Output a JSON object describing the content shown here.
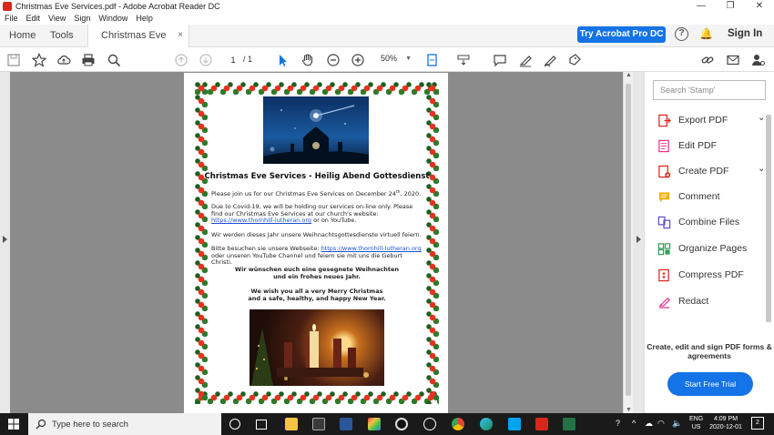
{
  "window": {
    "title": "Christmas Eve Services.pdf - Adobe Acrobat Reader DC",
    "min": "—",
    "max": "❐",
    "close": "✕"
  },
  "menu": [
    "File",
    "Edit",
    "View",
    "Sign",
    "Window",
    "Help"
  ],
  "tabs": {
    "home": "Home",
    "tools": "Tools",
    "doc": "Christmas Eve Servi...",
    "doc_close": "×"
  },
  "header": {
    "try_label": "Try Acrobat Pro DC",
    "help": "?",
    "signin": "Sign In"
  },
  "toolbar": {
    "page_current": "1",
    "page_total": "/ 1",
    "zoom": "50%"
  },
  "document": {
    "heading": "Christmas Eve Services - Heilig Abend Gottesdienst",
    "p1_a": "Please join us for our Christmas Eve Services on December 24",
    "p1_sup": "th",
    "p1_b": ", 2020.",
    "p2": "Due to Covid-19, we will be holding our services on-line only. Please find our Christmas Eve Services at our church's website:",
    "link1": "https://www.thornhill-lutheran.org",
    "p2_tail": " or on YouTube.",
    "p3": "Wir werden dieses Jahr unsere Weihnachtsgottesdienste virtuell feiern.",
    "p4_a": "Bitte besuchen sie unsere Webseite: ",
    "link2": "https://www.thornhill-lutheran.org",
    "p4_b": "oder unseren YouTube Channel und feiern sie mit uns die Geburt Christi.",
    "greet_de_1": "Wir wünschen euch eine gesegnete Weihnachten",
    "greet_de_2": "und ein frohes neues Jahr.",
    "greet_en_1": "We wish you all a very Merry Christmas",
    "greet_en_2": "and a safe, healthy, and happy New Year."
  },
  "panel": {
    "search_placeholder": "Search 'Stamp'",
    "tools": [
      {
        "label": "Export PDF",
        "color": "#d9261c"
      },
      {
        "label": "Edit PDF",
        "color": "#e0338a"
      },
      {
        "label": "Create PDF",
        "color": "#d9261c"
      },
      {
        "label": "Comment",
        "color": "#f2b01e"
      },
      {
        "label": "Combine Files",
        "color": "#5b4fc6"
      },
      {
        "label": "Organize Pages",
        "color": "#2e9e57"
      },
      {
        "label": "Compress PDF",
        "color": "#d9261c"
      },
      {
        "label": "Redact",
        "color": "#e0338a"
      }
    ],
    "promo": "Create, edit and sign PDF forms & agreements",
    "trial": "Start Free Trial"
  },
  "taskbar": {
    "search": "Type here to search",
    "lang_1": "ENG",
    "lang_2": "US",
    "time": "4:09 PM",
    "date": "2020-12-01",
    "notif_count": "2"
  }
}
